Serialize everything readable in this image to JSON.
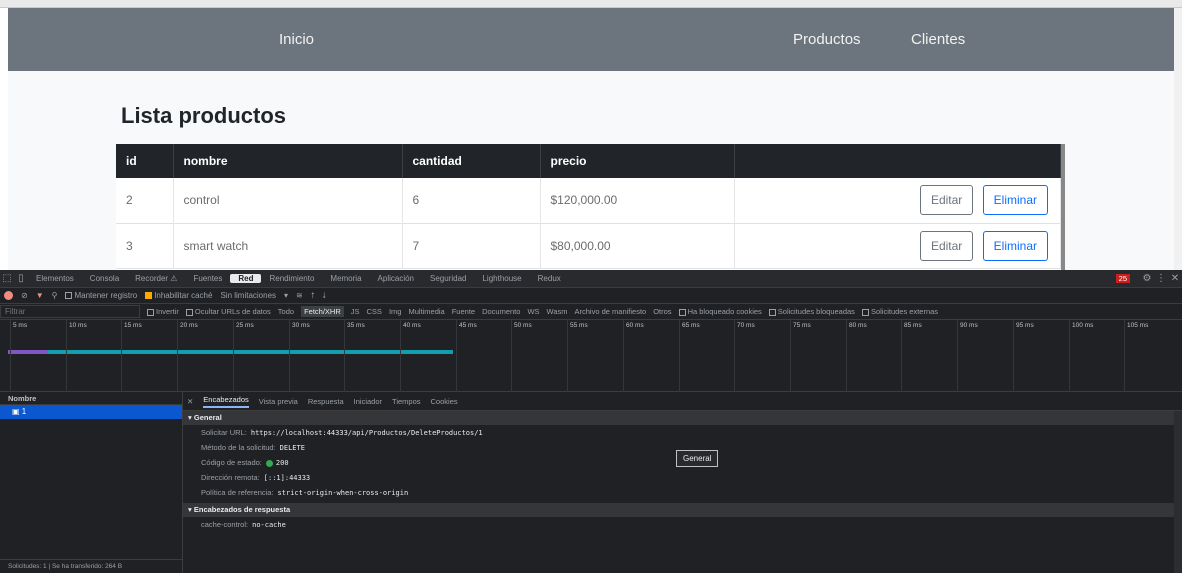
{
  "navbar": {
    "home": "Inicio",
    "products": "Productos",
    "clients": "Clientes"
  },
  "page_title": "Lista productos",
  "table": {
    "headers": [
      "id",
      "nombre",
      "cantidad",
      "precio",
      ""
    ],
    "rows": [
      {
        "id": "2",
        "nombre": "control",
        "cantidad": "6",
        "precio": "$120,000.00"
      },
      {
        "id": "3",
        "nombre": "smart watch",
        "cantidad": "7",
        "precio": "$80,000.00"
      }
    ],
    "edit_label": "Editar",
    "delete_label": "Eliminar"
  },
  "devtools": {
    "tabs": [
      "Elementos",
      "Consola",
      "Recorder ⚠",
      "Fuentes",
      "Red",
      "Rendimiento",
      "Memoria",
      "Aplicación",
      "Seguridad",
      "Lighthouse",
      "Redux"
    ],
    "active_tab": "Red",
    "issues_badge": "25",
    "toolbar": {
      "preserve_log": "Mantener registro",
      "disable_cache": "Inhabilitar caché",
      "throttling": "Sin limitaciones"
    },
    "filter": {
      "placeholder": "Filtrar",
      "invert": "Invertir",
      "hide_data_urls": "Ocultar URLs de datos",
      "types": [
        "Todo",
        "Fetch/XHR",
        "JS",
        "CSS",
        "Img",
        "Multimedia",
        "Fuente",
        "Documento",
        "WS",
        "Wasm",
        "Archivo de manifiesto",
        "Otros"
      ],
      "active_type": "Fetch/XHR",
      "blocked_cookies": "Ha bloqueado cookies",
      "blocked_requests": "Solicitudes bloqueadas",
      "third_party": "Solicitudes externas"
    },
    "timeline_ticks": [
      "5 ms",
      "10 ms",
      "15 ms",
      "20 ms",
      "25 ms",
      "30 ms",
      "35 ms",
      "40 ms",
      "45 ms",
      "50 ms",
      "55 ms",
      "60 ms",
      "65 ms",
      "70 ms",
      "75 ms",
      "80 ms",
      "85 ms",
      "90 ms",
      "95 ms",
      "100 ms",
      "105 ms"
    ],
    "request_list": {
      "header": "Nombre",
      "rows": [
        "1"
      ],
      "status": "Solicitudes: 1  |  Se ha transferido: 264 B"
    },
    "details": {
      "tabs": [
        "Encabezados",
        "Vista previa",
        "Respuesta",
        "Iniciador",
        "Tiempos",
        "Cookies"
      ],
      "active_tab": "Encabezados",
      "general_title": "General",
      "general": [
        {
          "key": "Solicitar URL:",
          "value": "https://localhost:44333/api/Productos/DeleteProductos/1"
        },
        {
          "key": "Método de la solicitud:",
          "value": "DELETE"
        },
        {
          "key": "Código de estado:",
          "value": "200"
        },
        {
          "key": "Dirección remota:",
          "value": "[::1]:44333"
        },
        {
          "key": "Política de referencia:",
          "value": "strict-origin-when-cross-origin"
        }
      ],
      "tooltip": "General",
      "response_headers_title": "Encabezados de respuesta",
      "response_headers": [
        {
          "key": "cache-control:",
          "value": "no-cache"
        }
      ]
    }
  },
  "colors": {
    "navbar": "#6c757d",
    "table_header": "#212529",
    "delete_accent": "#0d6efd",
    "devtools_bg": "#202124",
    "selected_row": "#0b57d0",
    "status_ok": "#34a853"
  }
}
